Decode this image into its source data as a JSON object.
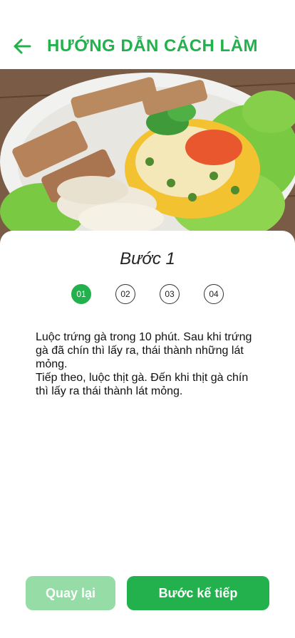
{
  "header": {
    "title": "HƯỚNG DẪN CÁCH LÀM"
  },
  "step": {
    "title": "Bước 1",
    "dots": [
      "01",
      "02",
      "03",
      "04"
    ],
    "active_index": 0
  },
  "instructions": {
    "paragraph_1": "Luộc trứng gà trong 10 phút. Sau khi trứng gà đã chín thì lấy ra, thái thành những lát mỏng.",
    "paragraph_2": "Tiếp theo, luộc thịt gà. Đến khi thịt gà chín thì lấy ra thái thành lát mỏng."
  },
  "buttons": {
    "back_label": "Quay lại",
    "next_label": "Bước kế tiếp"
  },
  "colors": {
    "accent": "#22b14c",
    "accent_light": "#96dca6"
  }
}
